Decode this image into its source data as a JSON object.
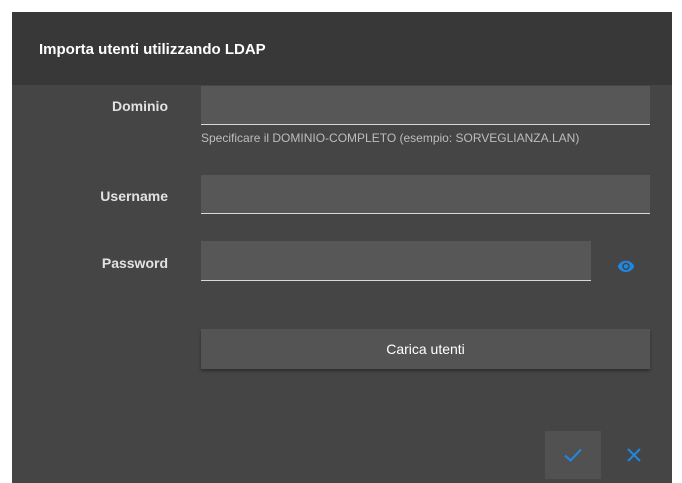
{
  "dialog": {
    "title": "Importa utenti utilizzando LDAP"
  },
  "form": {
    "domain": {
      "label": "Dominio",
      "value": "",
      "hint": "Specificare il DOMINIO-COMPLETO (esempio: SORVEGLIANZA.LAN)"
    },
    "username": {
      "label": "Username",
      "value": ""
    },
    "password": {
      "label": "Password",
      "value": ""
    },
    "load_button_label": "Carica utenti"
  },
  "actions": {
    "confirm_icon": "check-icon",
    "cancel_icon": "close-icon"
  },
  "colors": {
    "accent": "#1e88e5",
    "dialog_background": "#454545",
    "header_background": "#383838",
    "field_background": "#575757"
  }
}
